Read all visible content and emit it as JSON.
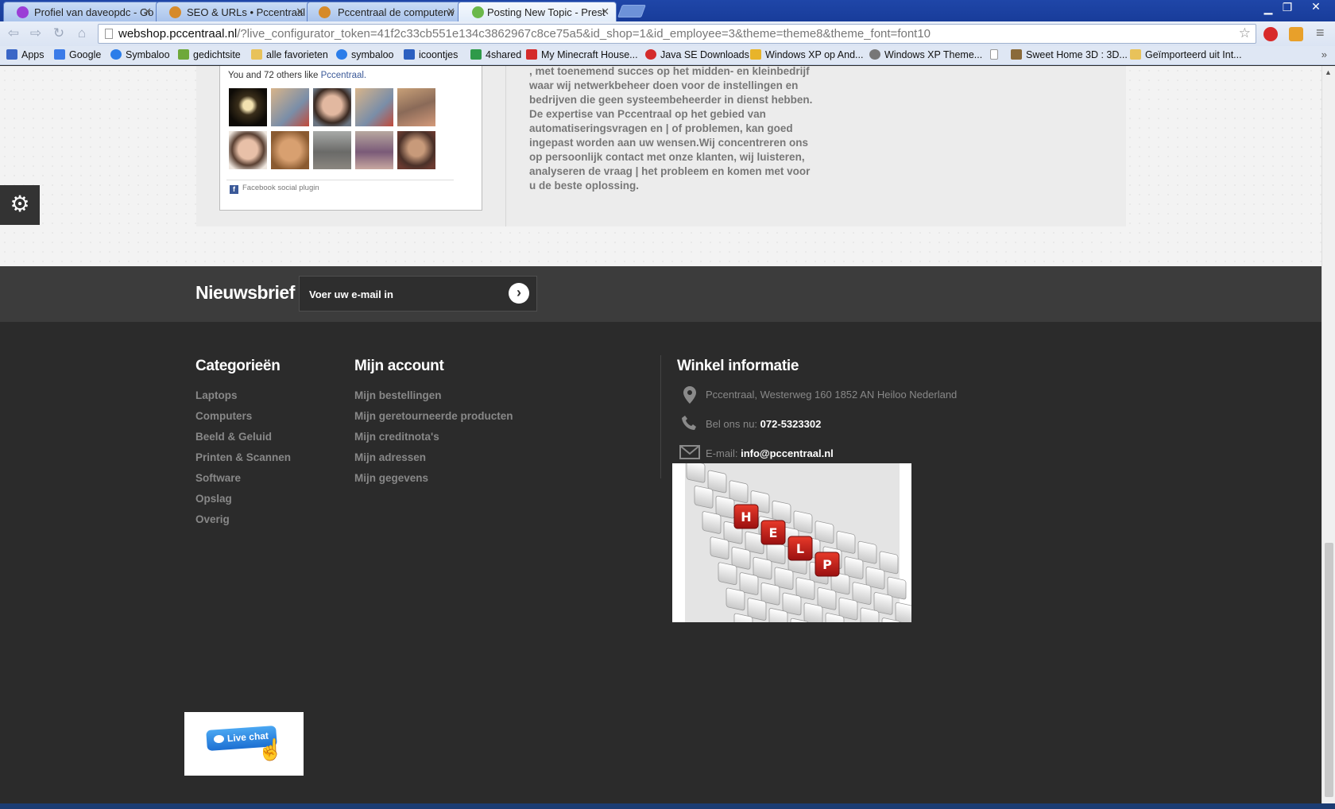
{
  "browser": {
    "tabs": [
      {
        "title": "Profiel van daveopdc - Go",
        "favicon_color": "#9b3dd6"
      },
      {
        "title": "SEO & URLs • Pccentraal c",
        "favicon_color": "#d68a2a"
      },
      {
        "title": "Pccentraal de computerw",
        "favicon_color": "#d68a2a"
      },
      {
        "title": "Posting New Topic - Prest",
        "favicon_color": "#6bb84a"
      }
    ],
    "url_host": "webshop.pccentraal.nl",
    "url_rest": "/?live_configurator_token=41f2c33cb551e134c3862967c8ce75a5&id_shop=1&id_employee=3&theme=theme8&theme_font=font10",
    "bookmarks": [
      {
        "label": "Apps",
        "icon_color": "#3a66c7"
      },
      {
        "label": "Google",
        "icon_color": "#3b7be8"
      },
      {
        "label": "Symbaloo",
        "icon_color": "#2b7de9"
      },
      {
        "label": "gedichtsite",
        "icon_color": "#6ea83a"
      },
      {
        "label": "alle favorieten",
        "icon_color": "#e8c25a"
      },
      {
        "label": "symbaloo",
        "icon_color": "#2b7de9"
      },
      {
        "label": "icoontjes",
        "icon_color": "#2b5fc0"
      },
      {
        "label": "4shared",
        "icon_color": "#2f9a4a"
      },
      {
        "label": "My Minecraft House...",
        "icon_color": "#d42b2b"
      },
      {
        "label": "Java SE Downloads",
        "icon_color": "#d42b2b"
      },
      {
        "label": "Windows XP op And...",
        "icon_color": "#e8b42a"
      },
      {
        "label": "Windows XP Theme...",
        "icon_color": "#777777"
      },
      {
        "label": "",
        "icon_color": "#ffffff"
      },
      {
        "label": "Sweet Home 3D : 3D...",
        "icon_color": "#8a6a3a"
      },
      {
        "label": "Geïmporteerd uit Int...",
        "icon_color": "#e8c25a"
      }
    ],
    "more": "»"
  },
  "facebook": {
    "likes_prefix": "You and 72 others like ",
    "page_name": "Pccentraal.",
    "plugin_label": "Facebook social plugin",
    "icon": "f",
    "face_colors": [
      "#2a2318",
      "#b88a5c",
      "#6f7a86",
      "#c0a080",
      "#a08c7a",
      "#c9b0a0",
      "#c08a4a",
      "#7c7a76",
      "#9a8a80",
      "#5a4038"
    ]
  },
  "about_text": ", met toenemend succes op het midden- en kleinbedrijf waar wij netwerkbeheer doen voor de instellingen en bedrijven die geen systeembeheerder in dienst hebben. De expertise van Pccentraal op het gebied van automatiseringsvragen en | of problemen, kan goed ingepast worden aan uw wensen.Wij concentreren ons op persoonlijk contact met onze klanten, wij luisteren, analyseren de vraag | het probleem en komen met voor u de beste oplossing.",
  "gear_icon": "⚙",
  "newsletter": {
    "title": "Nieuwsbrief",
    "placeholder": "Voer uw e-mail in",
    "submit_icon": "›"
  },
  "footer": {
    "categories": {
      "title": "Categorieën",
      "items": [
        "Laptops",
        "Computers",
        "Beeld & Geluid",
        "Printen & Scannen",
        "Software",
        "Opslag",
        "Overig"
      ]
    },
    "account": {
      "title": "Mijn account",
      "items": [
        "Mijn bestellingen",
        "Mijn geretourneerde producten",
        "Mijn creditnota's",
        "Mijn adressen",
        "Mijn gegevens"
      ]
    },
    "store": {
      "title": "Winkel informatie",
      "address": "Pccentraal, Westerweg 160 1852 AN Heiloo Nederland",
      "phone_label": "Bel ons nu:",
      "phone": "072-5323302",
      "email_label": "E-mail:",
      "email": "info@pccentraal.nl",
      "keyboard_keys": "HELP"
    },
    "live_chat_label": "Live chat"
  }
}
